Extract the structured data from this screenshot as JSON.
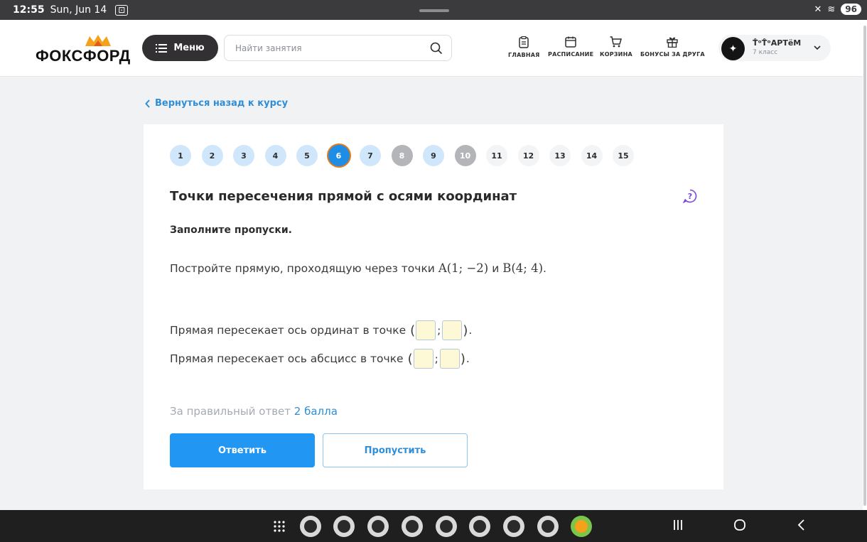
{
  "status_bar": {
    "time": "12:55",
    "date": "Sun, Jun 14",
    "battery": "96"
  },
  "header": {
    "logo": "ФОКСФОРД",
    "menu_label": "Меню",
    "search_placeholder": "Найти занятия",
    "nav": [
      {
        "label": "ГЛАВНАЯ",
        "icon": "clipboard-icon"
      },
      {
        "label": "РАСПИСАНИЕ",
        "icon": "calendar-icon"
      },
      {
        "label": "КОРЗИНА",
        "icon": "cart-icon"
      },
      {
        "label": "БОНУСЫ ЗА ДРУГА",
        "icon": "gift-icon"
      }
    ],
    "profile": {
      "name": "T̊ᵒT̊ᵒАРТёМ",
      "grade": "7 класс"
    }
  },
  "back_link": "Вернуться назад к курсу",
  "steps": [
    {
      "n": "1",
      "state": "done"
    },
    {
      "n": "2",
      "state": "done"
    },
    {
      "n": "3",
      "state": "done"
    },
    {
      "n": "4",
      "state": "done"
    },
    {
      "n": "5",
      "state": "done"
    },
    {
      "n": "6",
      "state": "active"
    },
    {
      "n": "7",
      "state": "done"
    },
    {
      "n": "8",
      "state": "skipped"
    },
    {
      "n": "9",
      "state": "done"
    },
    {
      "n": "10",
      "state": "skipped"
    },
    {
      "n": "11",
      "state": "todo"
    },
    {
      "n": "12",
      "state": "todo"
    },
    {
      "n": "13",
      "state": "todo"
    },
    {
      "n": "14",
      "state": "todo"
    },
    {
      "n": "15",
      "state": "todo"
    }
  ],
  "task": {
    "title": "Точки пересечения прямой с осями координат",
    "instruction": "Заполните пропуски.",
    "problem_text": "Постройте прямую, проходящую через точки",
    "point_a": "A(1; −2)",
    "conj": "и",
    "point_b": "B(4; 4)",
    "line1": "Прямая пересекает ось ординат в точке",
    "line2": "Прямая пересекает ось абсцисс в точке",
    "inputs": {
      "y_axis_x": "",
      "y_axis_y": "",
      "x_axis_x": "",
      "x_axis_y": ""
    }
  },
  "points": {
    "prefix": "За правильный ответ",
    "value": "2 балла"
  },
  "buttons": {
    "answer": "Ответить",
    "skip": "Пропустить"
  },
  "colors": {
    "accent": "#2196f3",
    "active_ring": "#e07a1f",
    "done": "#cfe6fb",
    "skipped": "#b4b5b8"
  }
}
